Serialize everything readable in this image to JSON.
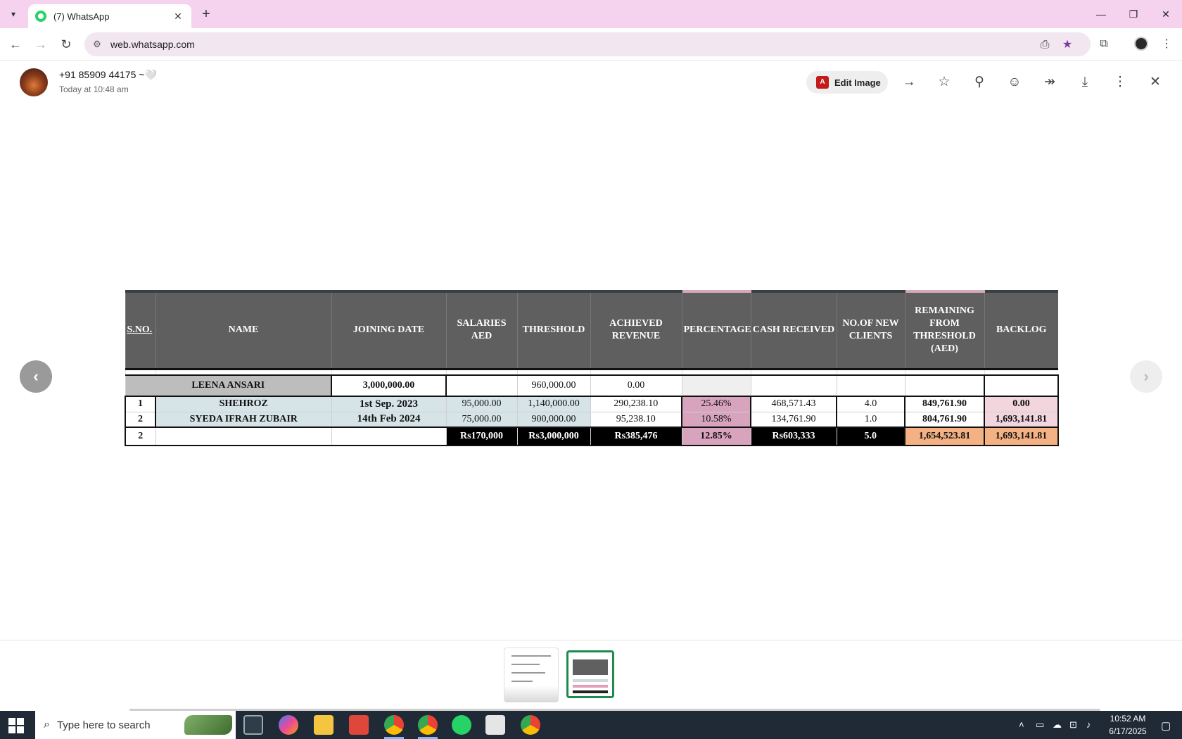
{
  "browser": {
    "tab_title": "(7) WhatsApp",
    "url": "web.whatsapp.com"
  },
  "viewer": {
    "contact_name": "+91 85909 44175 ~🤍",
    "timestamp": "Today at 10:48 am",
    "edit_image_label": "Edit Image"
  },
  "sheet": {
    "headers": [
      "S.NO.",
      "NAME",
      "JOINING DATE",
      "SALARIES AED",
      "THRESHOLD",
      "ACHIEVED REVENUE",
      "PERCENTAGE",
      "CASH RECEIVED",
      "NO.OF NEW CLIENTS",
      "REMAINING FROM THRESHOLD (AED)",
      "BACKLOG"
    ],
    "lead": {
      "name": "LEENA ANSARI",
      "joining": "3,000,000.00",
      "threshold": "960,000.00",
      "achieved": "0.00"
    },
    "rows": [
      {
        "sno": "1",
        "name": "SHEHROZ",
        "joining": "1st Sep. 2023",
        "salary": "95,000.00",
        "threshold": "1,140,000.00",
        "achieved": "290,238.10",
        "percentage": "25.46%",
        "cash": "468,571.43",
        "clients": "4.0",
        "remaining": "849,761.90",
        "backlog": "0.00"
      },
      {
        "sno": "2",
        "name": "SYEDA IFRAH ZUBAIR",
        "joining": "14th Feb 2024",
        "salary": "75,000.00",
        "threshold": "900,000.00",
        "achieved": "95,238.10",
        "percentage": "10.58%",
        "cash": "134,761.90",
        "clients": "1.0",
        "remaining": "804,761.90",
        "backlog": "1,693,141.81"
      }
    ],
    "total": {
      "sno": "2",
      "salary": "Rs170,000",
      "threshold": "Rs3,000,000",
      "achieved": "Rs385,476",
      "percentage": "12.85%",
      "cash": "Rs603,333",
      "clients": "5.0",
      "remaining": "1,654,523.81",
      "backlog": "1,693,141.81"
    }
  },
  "taskbar": {
    "search_placeholder": "Type here to search",
    "time": "10:52 AM",
    "date": "6/17/2025"
  },
  "colors": {
    "tabstrip": "#f5d3ee",
    "header_grey": "#5f5f5f",
    "light_blue": "#d6e4e8",
    "mauve": "#d8a3bd",
    "orange": "#f4b183",
    "selected_thumb": "#1e8a4e",
    "taskbar": "#1f2a36"
  }
}
